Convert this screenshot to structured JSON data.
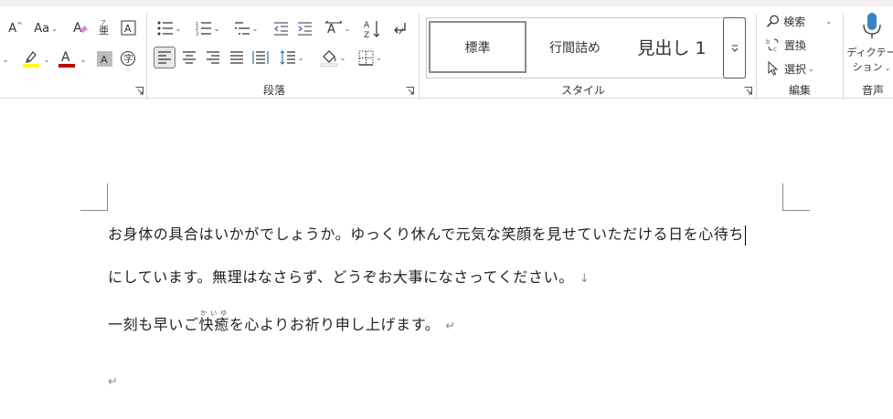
{
  "ribbon": {
    "font": {
      "grow_label": "A",
      "case_label": "Aa",
      "highlight_color": "#ffff00",
      "font_color": "#c00000",
      "font_color_letter": "A",
      "shade_letter": "A"
    },
    "paragraph": {
      "group_label": "段落",
      "sort_label": "A Z"
    },
    "styles": {
      "group_label": "スタイル",
      "items": [
        "標準",
        "行間詰め",
        "見出し 1"
      ]
    },
    "editing": {
      "group_label": "編集",
      "search_label": "検索",
      "replace_label": "置換",
      "select_label": "選択"
    },
    "voice": {
      "group_label": "音声",
      "dictate_label_1": "ディクテー",
      "dictate_label_2": "ション"
    }
  },
  "document": {
    "line1": "お身体の具合はいかがでしょうか。ゆっくり休んで元気な笑顔を見せていただける日を心待ち",
    "line2": "にしています。無理はなさらず、どうぞお大事になさってください。",
    "line2_mark": "↓",
    "line3_before": "一刻も早いご",
    "line3_ruby_base": "快癒",
    "line3_ruby_reading": "かいゆ",
    "line3_after": "を心よりお祈り申し上げます。",
    "paragraph_mark": "↵"
  }
}
